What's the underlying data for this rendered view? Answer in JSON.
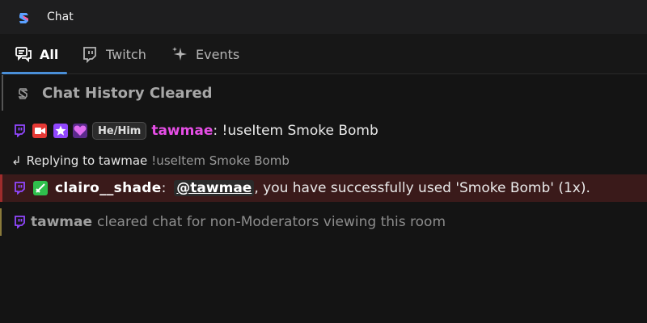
{
  "window": {
    "title": "Chat"
  },
  "tabs": [
    {
      "label": "All",
      "icon": "chat-bubbles-icon",
      "active": true
    },
    {
      "label": "Twitch",
      "icon": "twitch-icon",
      "active": false
    },
    {
      "label": "Events",
      "icon": "sparkle-icon",
      "active": false
    }
  ],
  "colors": {
    "accent": "#4a8fd8",
    "twitch": "#9147ff",
    "username_pink": "#e64ee6",
    "highlight_bg": "#3a1a1a",
    "highlight_border": "#9e2c2c"
  },
  "system_message": {
    "text": "Chat History Cleared"
  },
  "messages": [
    {
      "platform": "twitch",
      "badges": [
        "camera-badge",
        "star-badge",
        "heart-badge"
      ],
      "pronouns": "He/Him",
      "username": "tawmae",
      "separator": ":",
      "text": " !useItem Smoke Bomb"
    },
    {
      "reply": {
        "prefix": "Replying to tawmae",
        "quote": "!useItem Smoke Bomb"
      },
      "platform": "twitch",
      "badges": [
        "sword-badge"
      ],
      "username": "clairo__shade",
      "separator": ":",
      "mention": "@tawmae",
      "text": ", you have successfully used 'Smoke Bomb' (1x)."
    },
    {
      "platform": "twitch",
      "username": "tawmae",
      "text": "cleared chat for non-Moderators viewing this room"
    }
  ]
}
